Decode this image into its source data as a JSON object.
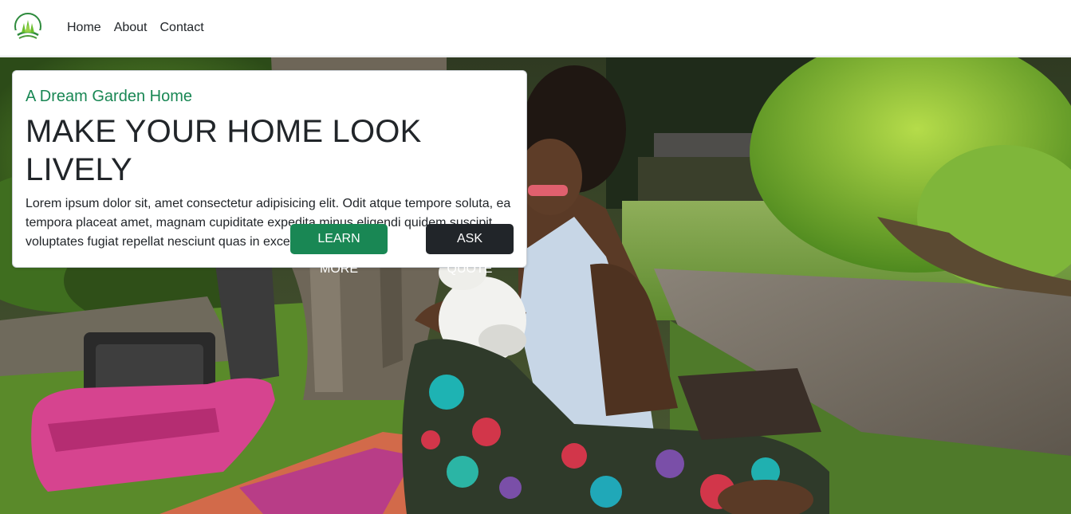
{
  "nav": {
    "brand_icon": "grass-leaf-logo-icon",
    "links": [
      {
        "label": "Home"
      },
      {
        "label": "About"
      },
      {
        "label": "Contact"
      }
    ]
  },
  "hero": {
    "image_description_icon": "hero-photo",
    "card": {
      "subtitle": "A Dream Garden Home",
      "title": "MAKE YOUR HOME LOOK LIVELY",
      "text": "Lorem ipsum dolor sit, amet consectetur adipisicing elit. Odit atque tempore soluta, ea tempora placeat amet, magnam cupiditate expedita minus eligendi quidem suscipit voluptates fugiat repellat nesciunt quas in excepturi.",
      "learn_more_label": "LEARN MORE",
      "ask_quote_label": "ASK QUOTE"
    }
  },
  "colors": {
    "accent": "#198754",
    "dark": "#212529",
    "text": "#212529"
  }
}
